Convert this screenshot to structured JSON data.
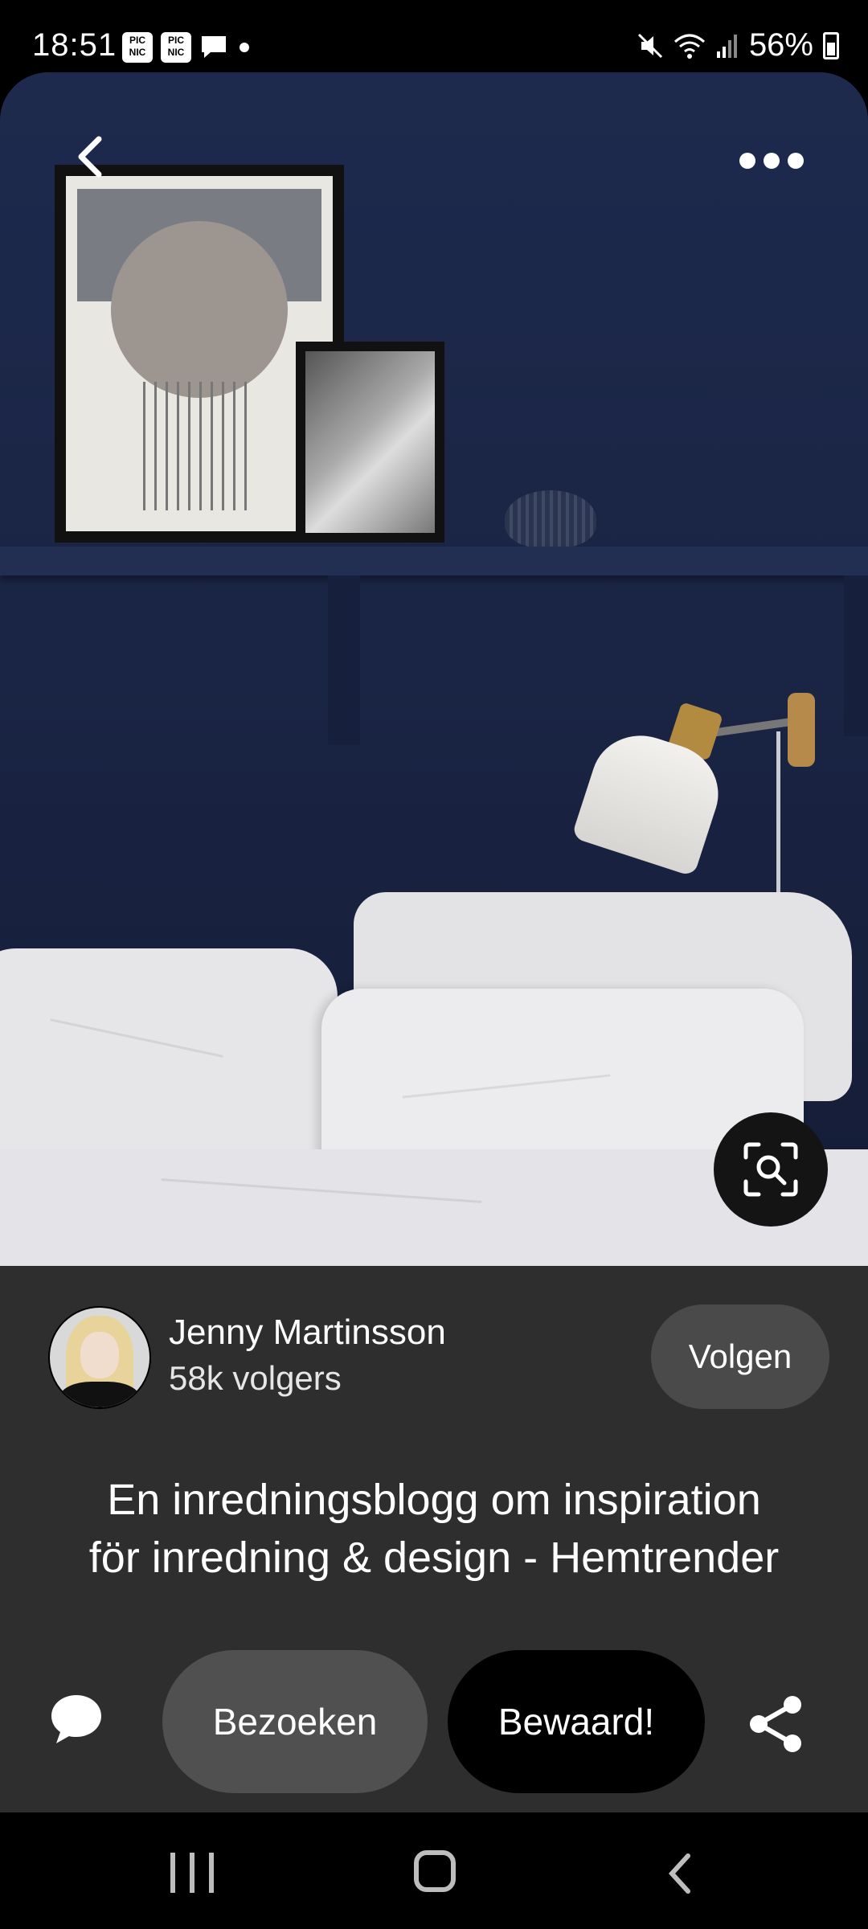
{
  "status_bar": {
    "time": "18:51",
    "notification_icons": [
      "picnic-icon",
      "picnic-icon",
      "chat-icon"
    ],
    "notif_glyph": "PIC NIC",
    "battery": "56%"
  },
  "pin": {
    "image_description_icon": "visual-search-icon"
  },
  "creator": {
    "name": "Jenny Martinsson",
    "followers": "58k volgers",
    "follow_label": "Volgen"
  },
  "title_line1": "En inredningsblogg om inspiration",
  "title_line2": "för inredning & design - Hemtrender",
  "actions": {
    "visit_label": "Bezoeken",
    "saved_label": "Bewaard!"
  },
  "colors": {
    "panel": "#2e2e2e",
    "follow_button": "#4a4a4a",
    "visit_button": "#505050",
    "saved_button": "#000000"
  }
}
